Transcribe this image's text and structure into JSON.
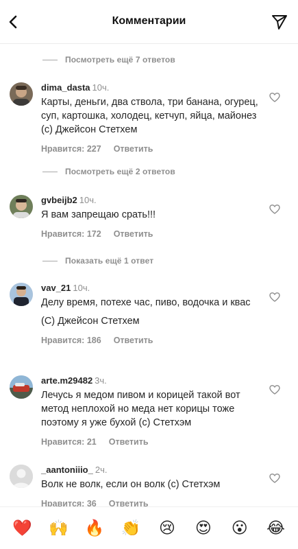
{
  "header": {
    "title": "Комментарии"
  },
  "more_replies": [
    "Посмотреть ещё 7 ответов",
    "Посмотреть ещё 2 ответов",
    "Показать ещё 1 ответ"
  ],
  "comments": [
    {
      "username": "dima_dasta",
      "time": "10ч.",
      "text": "Карты, деньги, два ствола, три банана, огурец, суп, картошка, холодец, кетчуп, яйца, майонез (с) Джейсон Стетхем",
      "likes": "Нравится: 227",
      "reply": "Ответить"
    },
    {
      "username": "gvbeijb2",
      "time": "10ч.",
      "text": "Я вам запрещаю срать!!!",
      "likes": "Нравится: 172",
      "reply": "Ответить"
    },
    {
      "username": "vav_21",
      "time": "10ч.",
      "text": "Делу время, потехе час, пиво, водочка и квас",
      "text2": "(С) Джейсон Стетхем",
      "likes": "Нравится: 186",
      "reply": "Ответить"
    },
    {
      "username": "arte.m29482",
      "time": "3ч.",
      "text": "Лечусь я медом пивом и корицей такой вот метод неплохой но меда нет корицы тоже поэтому я уже бухой (с) Стетхэм",
      "likes": "Нравится: 21",
      "reply": "Ответить"
    },
    {
      "username": "_aantoniiio_",
      "time": "2ч.",
      "text": "Волк не волк, если он волк (с) Стетхэм",
      "likes": "Нравится: 36",
      "reply": "Ответить"
    }
  ],
  "emoji_bar": [
    "❤️",
    "🙌",
    "🔥",
    "👏",
    "😢",
    "😍",
    "😮",
    "😂"
  ]
}
